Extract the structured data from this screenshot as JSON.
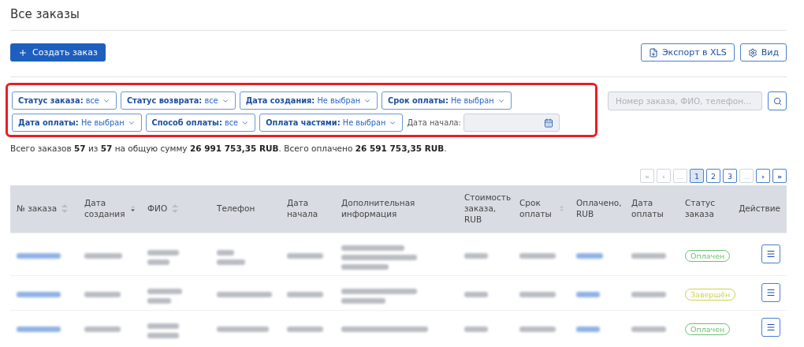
{
  "page_title": "Все заказы",
  "toolbar": {
    "create_button": "Создать заказ",
    "export_button": "Экспорт в XLS",
    "view_button": "Вид"
  },
  "filters": [
    {
      "kind": "dropdown",
      "label": "Статус заказа:",
      "value": "все"
    },
    {
      "kind": "dropdown",
      "label": "Статус возврата:",
      "value": "все"
    },
    {
      "kind": "dropdown",
      "label": "Дата создания:",
      "value": "Не выбран"
    },
    {
      "kind": "dropdown",
      "label": "Срок оплаты:",
      "value": "Не выбран"
    },
    {
      "kind": "dropdown",
      "label": "Дата оплаты:",
      "value": "Не выбран"
    },
    {
      "kind": "dropdown",
      "label": "Способ оплаты:",
      "value": "все"
    },
    {
      "kind": "dropdown",
      "label": "Оплата частями:",
      "value": "Не выбран"
    },
    {
      "kind": "date",
      "label": "Дата начала:"
    }
  ],
  "search": {
    "placeholder": "Номер заказа, ФИО, телефон..."
  },
  "summary": "Всего заказов **57** из **57** на общую сумму **26 991 753,35 RUB**. Всего оплачено **26 591 753,35 RUB**.",
  "pagination": [
    {
      "kind": "nav",
      "label": "«",
      "disabled": true,
      "selected": false
    },
    {
      "kind": "nav",
      "label": "‹",
      "disabled": true,
      "selected": false
    },
    {
      "kind": "page",
      "label": "...",
      "disabled": true,
      "selected": false
    },
    {
      "kind": "page",
      "label": "1",
      "disabled": false,
      "selected": true
    },
    {
      "kind": "page",
      "label": "2",
      "disabled": false,
      "selected": false
    },
    {
      "kind": "page",
      "label": "3",
      "disabled": false,
      "selected": false
    },
    {
      "kind": "page",
      "label": "...",
      "disabled": true,
      "selected": false
    },
    {
      "kind": "nav",
      "label": "›",
      "disabled": false,
      "selected": false
    },
    {
      "kind": "nav",
      "label": "»",
      "disabled": false,
      "selected": false
    }
  ],
  "table": {
    "columns": [
      {
        "label": "№ заказа",
        "sorted": false
      },
      {
        "label": "Дата создания",
        "sorted": true
      },
      {
        "label": "ФИО",
        "sorted": false
      },
      {
        "label": "Телефон"
      },
      {
        "label": "Дата начала"
      },
      {
        "label": "Дополнительная информация"
      },
      {
        "label": "Стоимость заказа, RUB"
      },
      {
        "label": "Срок оплаты",
        "sorted": false
      },
      {
        "label": "Оплачено, RUB"
      },
      {
        "label": "Дата оплаты"
      },
      {
        "label": "Статус заказа"
      },
      {
        "label": "Действие"
      }
    ],
    "rows": [
      {
        "status": "Оплачен",
        "color": "#6cbf6e"
      },
      {
        "status": "Завершён",
        "color": "#c9d24a"
      },
      {
        "status": "Оплачен",
        "color": "#6cbf6e"
      }
    ]
  }
}
